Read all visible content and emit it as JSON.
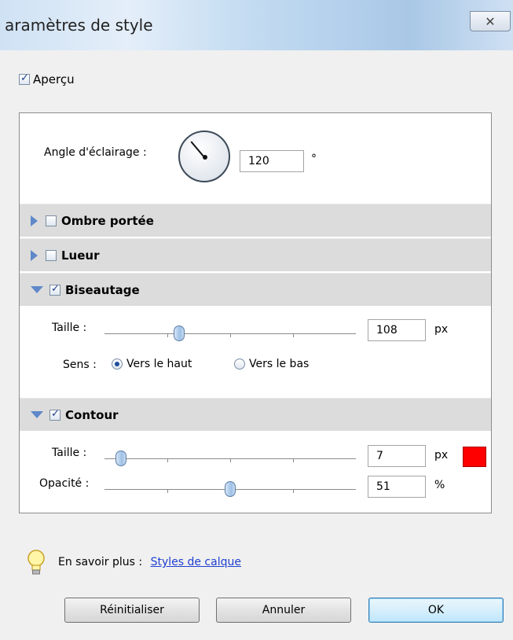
{
  "window": {
    "title": "aramètres de style",
    "close_icon": "✕"
  },
  "apercu": {
    "label": "Aperçu",
    "checked": true
  },
  "angle": {
    "label": "Angle d'éclairage :",
    "value": "120",
    "unit": "°"
  },
  "sections": {
    "ombre": {
      "label": "Ombre portée",
      "checked": false,
      "expanded": false
    },
    "lueur": {
      "label": "Lueur",
      "checked": false,
      "expanded": false
    },
    "biseautage": {
      "label": "Biseautage",
      "checked": true,
      "expanded": true,
      "taille_label": "Taille :",
      "taille_value": "108",
      "taille_unit": "px",
      "sens_label": "Sens :",
      "sens_haut": "Vers le haut",
      "sens_bas": "Vers le bas",
      "sens_selected": "Vers le haut"
    },
    "contour": {
      "label": "Contour",
      "checked": true,
      "expanded": true,
      "taille_label": "Taille :",
      "taille_value": "7",
      "taille_unit": "px",
      "opacite_label": "Opacité :",
      "opacite_value": "51",
      "opacite_unit": "%",
      "color": "#ff0000"
    }
  },
  "help": {
    "label": "En savoir plus :",
    "link": "Styles de calque"
  },
  "buttons": {
    "reset": "Réinitialiser",
    "cancel": "Annuler",
    "ok": "OK"
  },
  "colors": {
    "accent": "#5f88c9",
    "link": "#1f3fd0"
  }
}
